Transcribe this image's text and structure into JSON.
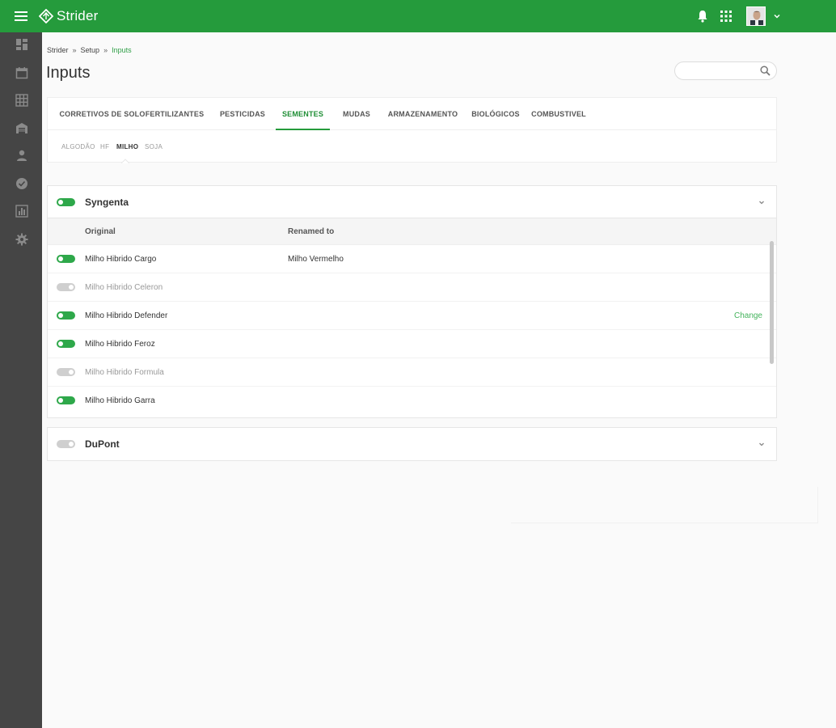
{
  "app": {
    "brand": "Strider",
    "accent": "#259b3c",
    "sidebar_bg": "#454545"
  },
  "topbar": {
    "menu_icon": "hamburger-icon",
    "notifications_icon": "bell-icon",
    "apps_icon": "apps-grid-icon",
    "account_caret_icon": "chevron-down-icon"
  },
  "sidebar": {
    "items": [
      {
        "name": "dashboard",
        "icon": "dashboard-icon"
      },
      {
        "name": "calendar",
        "icon": "calendar-icon"
      },
      {
        "name": "grid",
        "icon": "grid-icon"
      },
      {
        "name": "warehouse",
        "icon": "warehouse-icon"
      },
      {
        "name": "user",
        "icon": "person-icon"
      },
      {
        "name": "check",
        "icon": "check-circle-icon"
      },
      {
        "name": "reports",
        "icon": "chart-icon"
      },
      {
        "name": "settings",
        "icon": "gear-icon"
      }
    ]
  },
  "breadcrumb": {
    "items": [
      "Strider",
      "Setup",
      "Inputs"
    ],
    "separator": "»"
  },
  "page": {
    "title": "Inputs"
  },
  "search": {
    "value": "",
    "placeholder": ""
  },
  "tabs": [
    {
      "label": "CORRETIVOS DE SOLO",
      "active": false
    },
    {
      "label": "FERTILIZANTES",
      "active": false
    },
    {
      "label": "PESTICIDAS",
      "active": false
    },
    {
      "label": "SEMENTES",
      "active": true
    },
    {
      "label": "MUDAS",
      "active": false
    },
    {
      "label": "ARMAZENAMENTO",
      "active": false
    },
    {
      "label": "BIOLÓGICOS",
      "active": false
    },
    {
      "label": "COMBUSTIVEL",
      "active": false
    }
  ],
  "subtabs": [
    {
      "label": "ALGODÃO",
      "active": false
    },
    {
      "label": "HF",
      "active": false
    },
    {
      "label": "MILHO",
      "active": true
    },
    {
      "label": "SOJA",
      "active": false
    }
  ],
  "groups": [
    {
      "name": "Syngenta",
      "enabled": true,
      "expanded": true,
      "columns": {
        "original": "Original",
        "renamed": "Renamed to"
      },
      "rows": [
        {
          "original": "Milho Hibrido Cargo",
          "renamed": "Milho Vermelho",
          "enabled": true,
          "action": ""
        },
        {
          "original": "Milho Hibrido Celeron",
          "renamed": "",
          "enabled": false,
          "action": ""
        },
        {
          "original": "Milho Hibrido Defender",
          "renamed": "",
          "enabled": true,
          "action": "Change"
        },
        {
          "original": "Milho Hibrido Feroz",
          "renamed": "",
          "enabled": true,
          "action": ""
        },
        {
          "original": "Milho Hibrido Formula",
          "renamed": "",
          "enabled": false,
          "action": ""
        },
        {
          "original": "Milho Hibrido Garra",
          "renamed": "",
          "enabled": true,
          "action": ""
        }
      ]
    },
    {
      "name": "DuPont",
      "enabled": false,
      "expanded": false
    }
  ]
}
